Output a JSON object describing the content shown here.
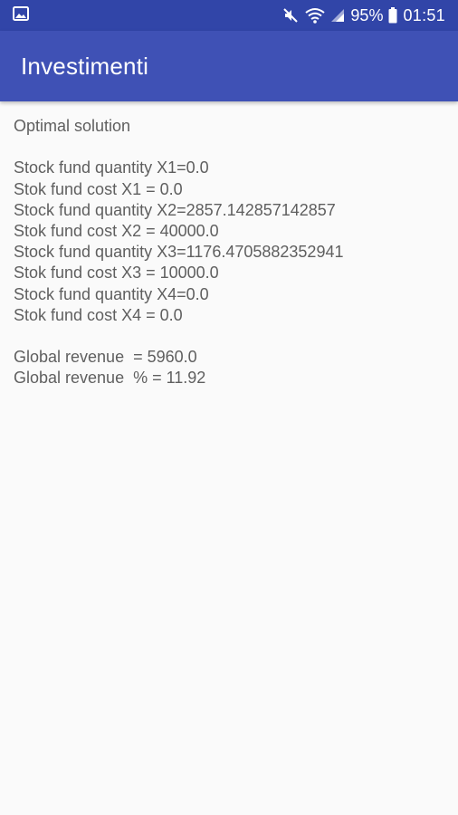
{
  "status_bar": {
    "battery": "95%",
    "time": "01:51",
    "icons": {
      "left": "image-notification-icon",
      "mute": "vibrate-mute-icon",
      "wifi": "wifi-icon",
      "signal": "cell-signal-icon",
      "battery": "battery-icon"
    }
  },
  "app_bar": {
    "title": "Investimenti"
  },
  "content": {
    "heading": "Optimal solution",
    "lines": [
      "Stock fund quantity X1=0.0",
      "Stok fund cost X1 = 0.0",
      "Stock fund quantity X2=2857.142857142857",
      "Stok fund cost X2 = 40000.0",
      "Stock fund quantity X3=1176.4705882352941",
      "Stok fund cost X3 = 10000.0",
      "Stock fund quantity X4=0.0",
      "Stok fund cost X4 = 0.0"
    ],
    "revenue": "Global revenue  = 5960.0",
    "revenue_percent": "Global revenue  % = 11.92"
  },
  "colors": {
    "status_bar": "#3145a8",
    "app_bar": "#3f51b5",
    "background": "#fafafa",
    "text": "#5f5f5f"
  }
}
